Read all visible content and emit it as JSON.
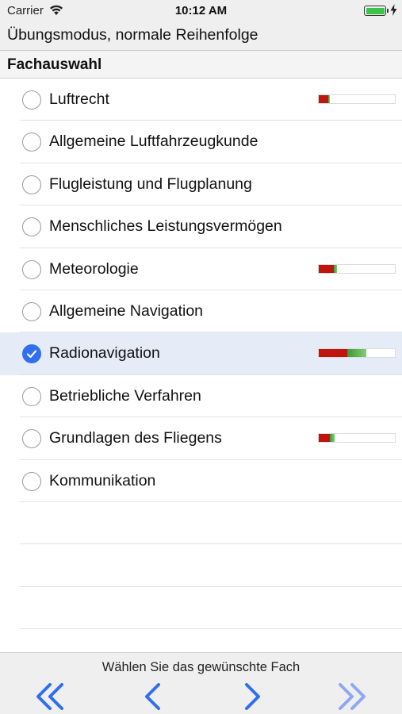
{
  "status_bar": {
    "carrier": "Carrier",
    "time": "10:12 AM",
    "battery_level": 1.0
  },
  "header": {
    "mode_title": "Übungsmodus, normale Reihenfolge"
  },
  "section": {
    "title": "Fachauswahl"
  },
  "subjects": [
    {
      "label": "Luftrecht",
      "selected": false,
      "progress": {
        "red": 0.12,
        "green": 0.03
      }
    },
    {
      "label": "Allgemeine Luftfahrzeugkunde",
      "selected": false,
      "progress": null
    },
    {
      "label": "Flugleistung und Flugplanung",
      "selected": false,
      "progress": null
    },
    {
      "label": "Menschliches Leistungsvermögen",
      "selected": false,
      "progress": null
    },
    {
      "label": "Meteorologie",
      "selected": false,
      "progress": {
        "red": 0.2,
        "green": 0.04
      }
    },
    {
      "label": "Allgemeine Navigation",
      "selected": false,
      "progress": null
    },
    {
      "label": "Radionavigation",
      "selected": true,
      "progress": {
        "red": 0.38,
        "green": 0.25
      }
    },
    {
      "label": "Betriebliche Verfahren",
      "selected": false,
      "progress": null
    },
    {
      "label": "Grundlagen des Fliegens",
      "selected": false,
      "progress": {
        "red": 0.15,
        "green": 0.06
      }
    },
    {
      "label": "Kommunikation",
      "selected": false,
      "progress": null
    }
  ],
  "footer": {
    "hint": "Wählen Sie das gewünschte Fach",
    "buttons": [
      {
        "icon": "double-chevron-left-icon",
        "enabled": true
      },
      {
        "icon": "chevron-left-icon",
        "enabled": true
      },
      {
        "icon": "chevron-right-icon",
        "enabled": true
      },
      {
        "icon": "double-chevron-right-icon",
        "enabled": false
      }
    ]
  },
  "colors": {
    "accent": "#2f6ff0",
    "progress_red": "#c0140e",
    "progress_green": "#3a9a35",
    "selected_row": "#e6ecf7",
    "disabled_icon": "#8fa9f0"
  }
}
